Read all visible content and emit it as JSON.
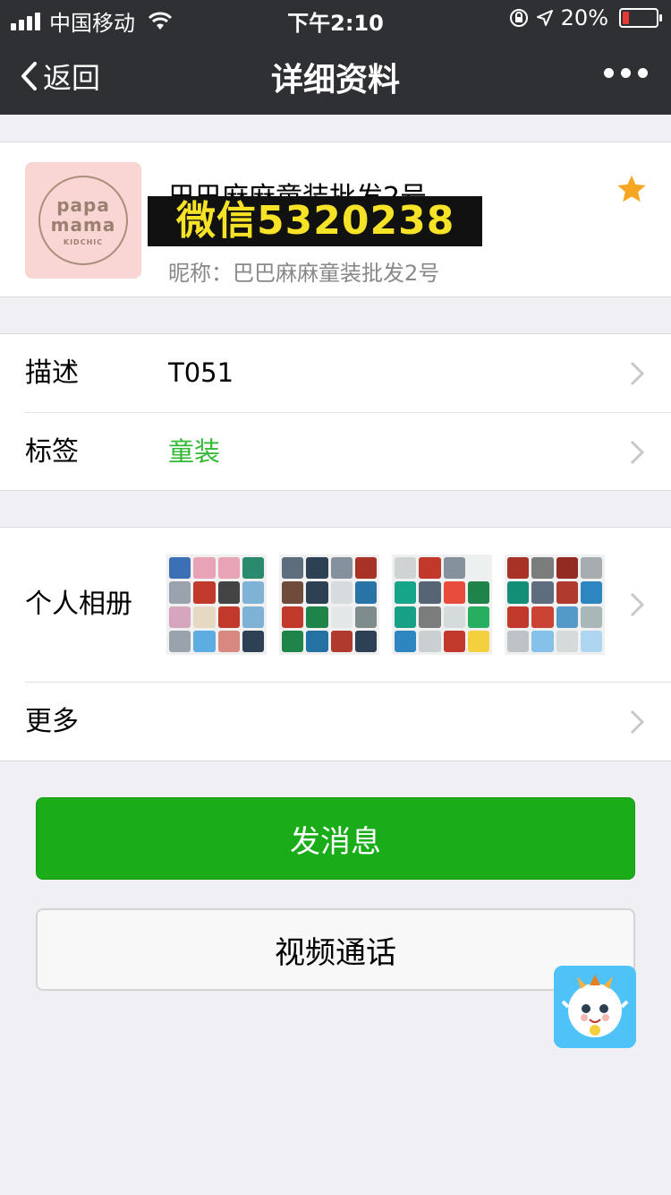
{
  "status_bar": {
    "carrier": "中国移动",
    "time": "下午2:10",
    "battery_percent": "20%",
    "battery_level": 0.2,
    "icons": [
      "signal-icon",
      "wifi-icon",
      "rotation-lock-icon",
      "location-arrow-icon",
      "battery-icon"
    ]
  },
  "nav": {
    "back_label": "返回",
    "title": "详细资料",
    "more_icon": "more-dots-icon"
  },
  "profile": {
    "avatar_text_line1": "papa",
    "avatar_text_line2": "mama",
    "avatar_text_line3": "KIDCHIC",
    "name": "巴巴麻麻童装批发2号",
    "overlay_text": "微信5320238",
    "nickname": "昵称：巴巴麻麻童装批发2号",
    "star_color": "#f5a623"
  },
  "details": {
    "description_label": "描述",
    "description_value": "T051",
    "tag_label": "标签",
    "tag_value": "童装",
    "tag_color": "#32b934"
  },
  "album": {
    "label": "个人相册",
    "more_label": "更多",
    "thumbnail_count": 4
  },
  "actions": {
    "send_message": "发消息",
    "video_call": "视频通话",
    "primary_color": "#1aad19"
  }
}
